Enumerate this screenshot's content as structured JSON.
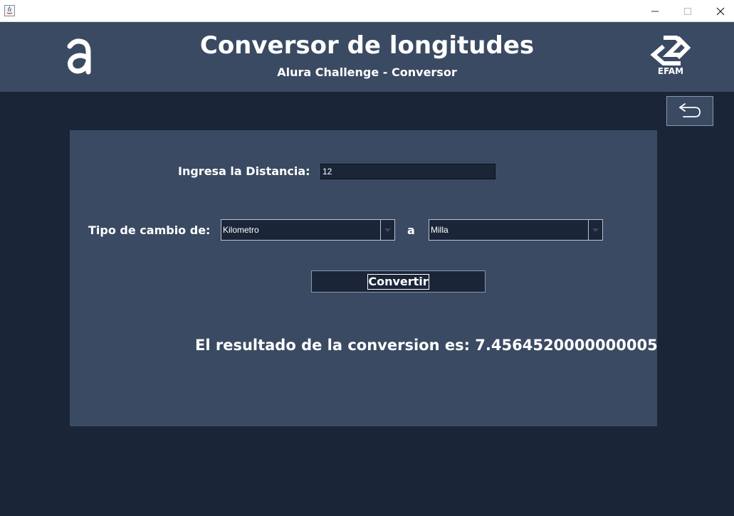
{
  "window": {
    "minimize_glyph": "—",
    "maximize_glyph": "☐",
    "close_glyph": "✕"
  },
  "header": {
    "title": "Conversor de longitudes",
    "subtitle": "Alura Challenge - Conversor",
    "left_logo_icon": "alura-logo-icon",
    "right_logo_icon": "efam-logo-icon",
    "right_logo_text": "EFAM"
  },
  "back_button": {
    "icon": "undo-arrow-icon"
  },
  "form": {
    "distance_label": "Ingresa la Distancia:",
    "distance_value": "12",
    "type_label": "Tipo de cambio de:",
    "from_unit": "Kilometro",
    "connector": "a",
    "to_unit": "Milla",
    "convert_label": "Convertir"
  },
  "result": {
    "text": "El resultado de la conversion es: 7.4564520000000005"
  },
  "colors": {
    "background": "#1a2638",
    "panel": "#3a4a62",
    "text": "#ffffff"
  }
}
